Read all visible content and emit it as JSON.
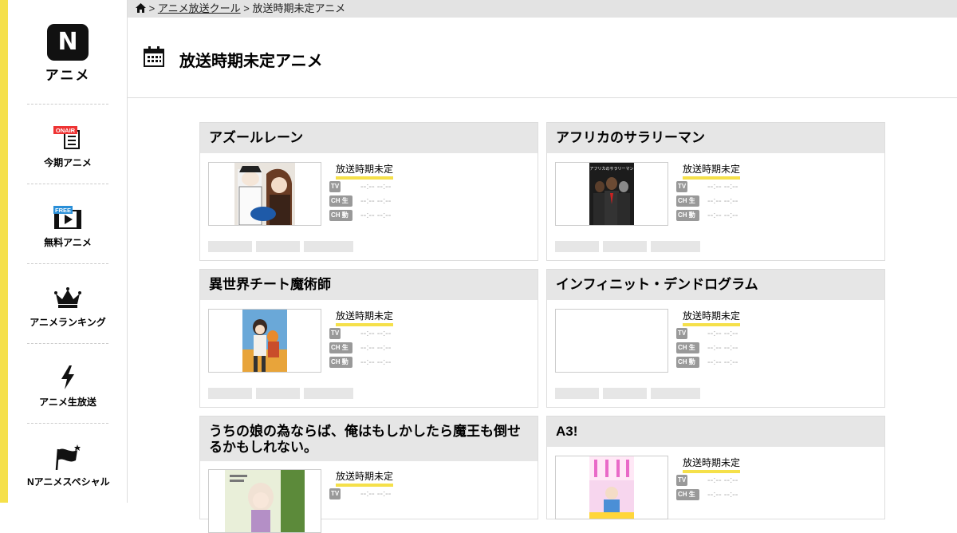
{
  "logo": {
    "mark": "N",
    "text": "アニメ"
  },
  "sidebar": {
    "items": [
      {
        "label": "今期アニメ",
        "badge": "ONAIR"
      },
      {
        "label": "無料アニメ",
        "badge": "FREE"
      },
      {
        "label": "アニメランキング"
      },
      {
        "label": "アニメ生放送"
      },
      {
        "label": "Nアニメスペシャル"
      }
    ]
  },
  "breadcrumb": {
    "sep": ">",
    "link": "アニメ放送クール",
    "current": "放送時期未定アニメ"
  },
  "page": {
    "title": "放送時期未定アニメ"
  },
  "schedule_labels": {
    "tv": "TV",
    "ch_live": "CH 生",
    "ch_video": "CH 動"
  },
  "time_placeholder": "--:-- --:--",
  "colors": {
    "accent": "#f5e04a",
    "badge": "#999999",
    "card_header": "#e6e6e6"
  },
  "cards": [
    {
      "title": "アズールレーン",
      "status": "放送時期未定"
    },
    {
      "title": "アフリカのサラリーマン",
      "status": "放送時期未定",
      "thumb_caption": "アフリカのサラリーマン"
    },
    {
      "title": "異世界チート魔術師",
      "status": "放送時期未定"
    },
    {
      "title": "インフィニット・デンドログラム",
      "status": "放送時期未定"
    },
    {
      "title": "うちの娘の為ならば、俺はもしかしたら魔王も倒せるかもしれない。",
      "status": "放送時期未定"
    },
    {
      "title": "A3!",
      "status": "放送時期未定"
    }
  ]
}
